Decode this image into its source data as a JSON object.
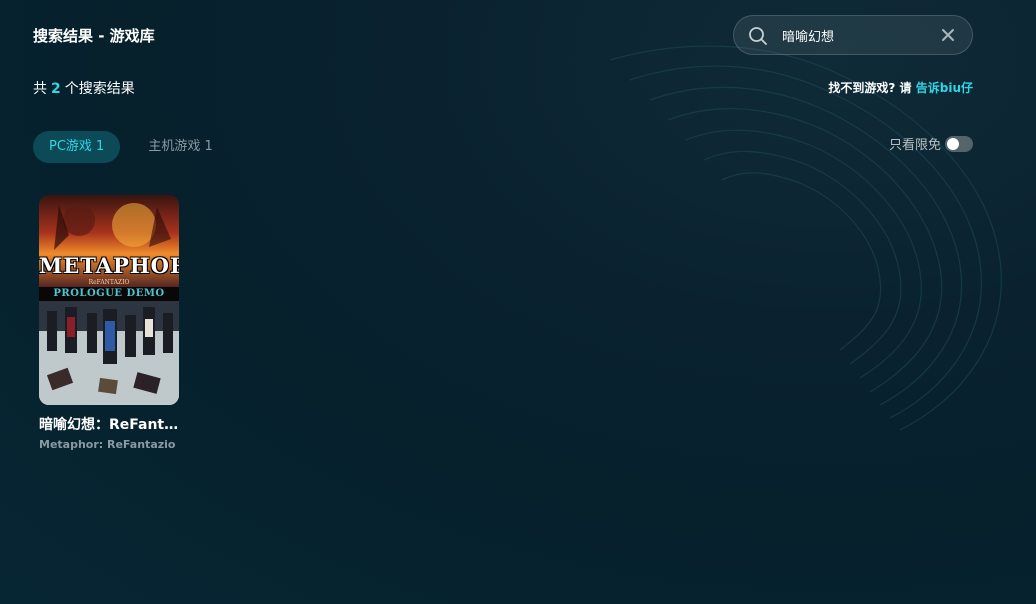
{
  "page": {
    "title": "搜索结果 - 游戏库"
  },
  "search": {
    "value": "暗喻幻想",
    "placeholder": ""
  },
  "results": {
    "prefix": "共",
    "count": "2",
    "suffix": "个搜索结果"
  },
  "help": {
    "text": "找不到游戏? 请 ",
    "link": "告诉biu仔"
  },
  "tabs": [
    {
      "label": "PC游戏 1",
      "active": true
    },
    {
      "label": "主机游戏 1",
      "active": false
    }
  ],
  "filter": {
    "label": "只看限免",
    "enabled": false
  },
  "games": [
    {
      "title": "暗喻幻想：ReFantazio",
      "subtitle": "Metaphor: ReFantazio",
      "cover_text": {
        "logo": "METAPHOR",
        "logo_sub": "ReFANTAZIO",
        "band": "PROLOGUE DEMO"
      }
    }
  ],
  "colors": {
    "accent": "#2fd6e6",
    "tab_active_bg": "#0d4a58",
    "background": "#0a2230"
  },
  "icons": {
    "search": "search-icon",
    "clear": "close-icon"
  }
}
